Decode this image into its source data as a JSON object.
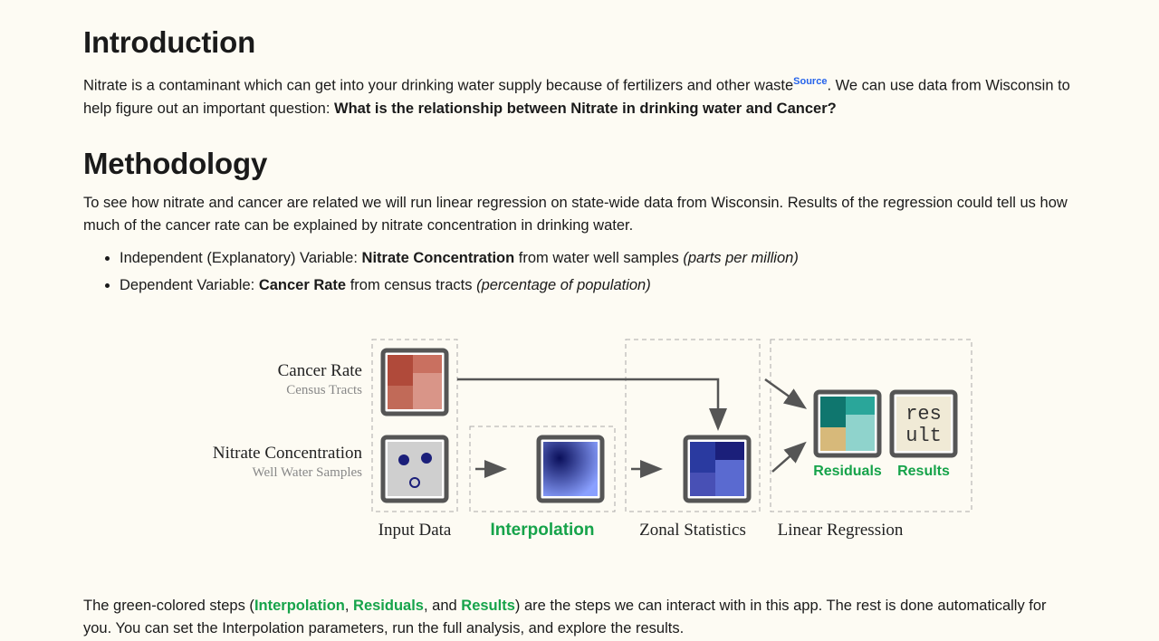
{
  "intro": {
    "heading": "Introduction",
    "p1a": "Nitrate is a contaminant which can get into your drinking water supply because of fertilizers and other waste",
    "source_label": "Source",
    "p1b": ". We can use data from Wisconsin to help figure out an important question: ",
    "p1_bold": "What is the relationship between Nitrate in drinking water and Cancer?"
  },
  "method": {
    "heading": "Methodology",
    "p1": "To see how nitrate and cancer are related we will run linear regression on state-wide data from Wisconsin. Results of the regression could tell us how much of the cancer rate can be explained by nitrate concentration in drinking water.",
    "bullets": {
      "b1_a": "Independent (Explanatory) Variable: ",
      "b1_bold": "Nitrate Concentration",
      "b1_b": " from water well samples ",
      "b1_it": "(parts per million)",
      "b2_a": "Dependent Variable: ",
      "b2_bold": "Cancer Rate",
      "b2_b": " from census tracts ",
      "b2_it": "(percentage of population)"
    }
  },
  "diagram": {
    "cancer_label": "Cancer Rate",
    "cancer_sub": "Census Tracts",
    "nitrate_label": "Nitrate Concentration",
    "nitrate_sub": "Well Water Samples",
    "steps": {
      "input": "Input Data",
      "interp": "Interpolation",
      "zonal": "Zonal Statistics",
      "linreg": "Linear Regression"
    },
    "results_box": {
      "residuals": "Residuals",
      "results": "Results",
      "res": "res",
      "ult": "ult"
    }
  },
  "footer": {
    "a": "The green-colored steps (",
    "g1": "Interpolation",
    "sep1": ", ",
    "g2": "Residuals",
    "sep2": ", and ",
    "g3": "Results",
    "b": ") are the steps we can interact with in this app. The rest is done automatically for you. You can set the Interpolation parameters, run the full analysis, and explore the results."
  }
}
